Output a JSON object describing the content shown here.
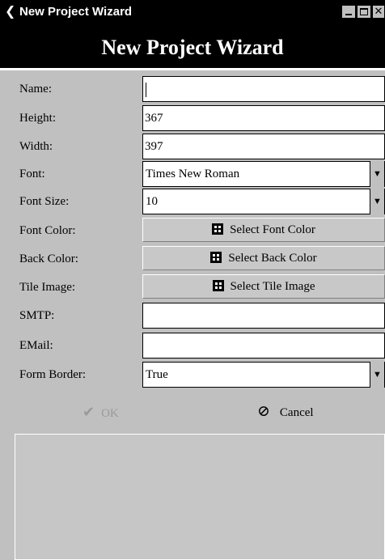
{
  "window": {
    "title": "New Project Wizard",
    "back_icon": "back-arrow-icon",
    "controls": {
      "minimize": "minimize-icon",
      "maximize": "maximize-icon",
      "close": "close-icon"
    }
  },
  "header": {
    "title": "New Project Wizard"
  },
  "form": {
    "name": {
      "label": "Name:",
      "value": ""
    },
    "height": {
      "label": "Height:",
      "value": "367"
    },
    "width": {
      "label": "Width:",
      "value": "397"
    },
    "font": {
      "label": "Font:",
      "value": "Times New Roman"
    },
    "font_size": {
      "label": "Font Size:",
      "value": "10"
    },
    "font_color": {
      "label": "Font Color:",
      "button": "Select Font Color"
    },
    "back_color": {
      "label": "Back Color:",
      "button": "Select Back Color"
    },
    "tile_image": {
      "label": "Tile Image:",
      "button": "Select Tile Image"
    },
    "smtp": {
      "label": "SMTP:",
      "value": ""
    },
    "email": {
      "label": "EMail:",
      "value": ""
    },
    "form_border": {
      "label": "Form Border:",
      "value": "True"
    }
  },
  "actions": {
    "ok": {
      "label": "OK",
      "icon": "checkmark-icon",
      "enabled": false
    },
    "cancel": {
      "label": "Cancel",
      "icon": "cancel-icon"
    }
  }
}
